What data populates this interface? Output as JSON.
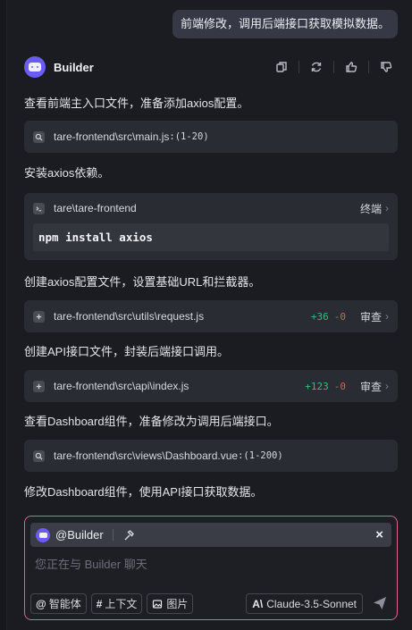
{
  "user_message": "前端修改，调用后端接口获取模拟数据。",
  "bot": {
    "name": "Builder"
  },
  "steps": [
    {
      "text": "查看前端主入口文件，准备添加axios配置。"
    },
    {
      "file": "tare-frontend\\src\\main.js",
      "range": ":(1-20)"
    },
    {
      "text": "安装axios依赖。"
    },
    {
      "terminal_path": "tare\\tare-frontend",
      "terminal_label": "终端",
      "command": "npm install axios"
    },
    {
      "text": "创建axios配置文件，设置基础URL和拦截器。"
    },
    {
      "file": "tare-frontend\\src\\utils\\request.js",
      "added": "+36",
      "removed": "-0",
      "review": "审查"
    },
    {
      "text": "创建API接口文件，封装后端接口调用。"
    },
    {
      "file": "tare-frontend\\src\\api\\index.js",
      "added": "+123",
      "removed": "-0",
      "review": "审查"
    },
    {
      "text": "查看Dashboard组件，准备修改为调用后端接口。"
    },
    {
      "file": "tare-frontend\\src\\views\\Dashboard.vue",
      "range": ":(1-200)"
    },
    {
      "text": "修改Dashboard组件，使用API接口获取数据。"
    }
  ],
  "composer": {
    "mention": "@Builder",
    "placeholder": "您正在与 Builder 聊天",
    "chips": [
      {
        "icon": "@",
        "label": "智能体"
      },
      {
        "icon": "#",
        "label": "上下文"
      },
      {
        "icon": "image-icon",
        "label": "图片"
      }
    ],
    "model": "Claude-3.5-Sonnet",
    "accent_color": "#e2628a"
  }
}
